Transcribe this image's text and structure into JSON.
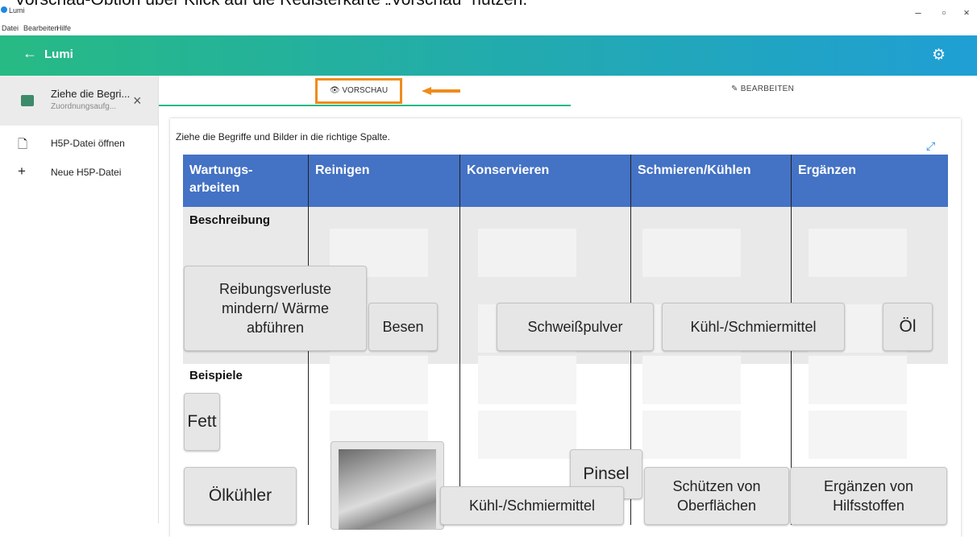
{
  "caption": "Vorschau-Option über Klick auf die Registerkarte „Vorschau“ nutzen.",
  "window": {
    "title": "Lumi",
    "menu": [
      "Datei",
      "Bearbeiten",
      "Hilfe"
    ]
  },
  "appbar": {
    "title": "Lumi",
    "back_icon": "arrow-left-icon",
    "settings_icon": "gear-icon"
  },
  "sidebar": {
    "open_file": {
      "name": "Ziehe die Begri...",
      "type": "Zuordnungsaufg..."
    },
    "items": [
      {
        "icon": "file-icon",
        "label": "H5P-Datei öffnen"
      },
      {
        "icon": "plus-icon",
        "label": "Neue H5P-Datei"
      }
    ]
  },
  "tabs": {
    "preview": "VORSCHAU",
    "edit": "BEARBEITEN",
    "accent": "#27ba84",
    "highlight": "#ef8c1b"
  },
  "task": "Ziehe die Begriffe und Bilder in die richtige Spalte.",
  "table": {
    "headers": [
      "Wartungs-arbeiten",
      "Reinigen",
      "Konservieren",
      "Schmieren/Kühlen",
      "Ergänzen"
    ],
    "rows": [
      "Beschreibung",
      "Beispiele"
    ],
    "header_color": "#4472c4"
  },
  "draggables": {
    "reibung": "Reibungsverluste mindern/ Wärme abführen",
    "besen": "Besen",
    "schweiss": "Schweißpulver",
    "kuehl1": "Kühl-/Schmiermittel",
    "oel": "Öl",
    "fett": "Fett",
    "oelkuehler": "Ölkühler",
    "pinsel": "Pinsel",
    "kuehl2": "Kühl-/Schmiermittel",
    "schuetzen": "Schützen von Oberflächen",
    "ergaenzen": "Ergänzen von Hilfsstoffen"
  }
}
